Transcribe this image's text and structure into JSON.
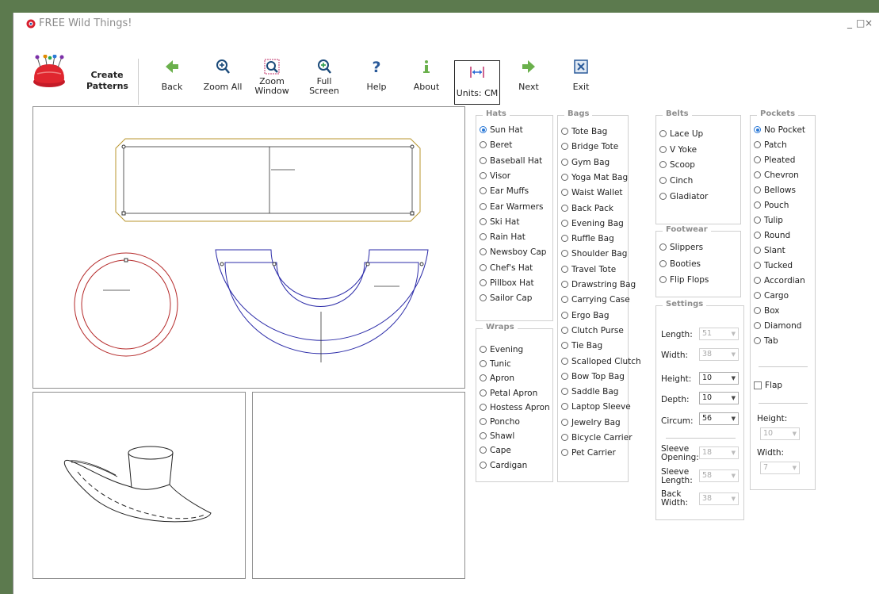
{
  "window": {
    "title": "FREE Wild Things!",
    "minimize": "_",
    "maximize": "□",
    "close": "×"
  },
  "brand": {
    "line1": "Create",
    "line2": "Patterns"
  },
  "toolbar": {
    "back": "Back",
    "zoom_all": "Zoom All",
    "zoom_window": "Zoom\nWindow",
    "full_screen": "Full\nScreen",
    "help": "Help",
    "about": "About",
    "units": "Units: CM",
    "next": "Next",
    "exit": "Exit"
  },
  "hats": {
    "title": "Hats",
    "items": [
      "Sun Hat",
      "Beret",
      "Baseball Hat",
      "Visor",
      "Ear Muffs",
      "Ear Warmers",
      "Ski Hat",
      "Rain Hat",
      "Newsboy Cap",
      "Chef's Hat",
      "Pillbox Hat",
      "Sailor Cap"
    ],
    "selected": "Sun Hat"
  },
  "wraps": {
    "title": "Wraps",
    "items": [
      "Evening",
      "Tunic",
      "Apron",
      "Petal Apron",
      "Hostess Apron",
      "Poncho",
      "Shawl",
      "Cape",
      "Cardigan"
    ]
  },
  "bags": {
    "title": "Bags",
    "items": [
      "Tote Bag",
      "Bridge Tote",
      "Gym Bag",
      "Yoga Mat Bag",
      "Waist Wallet",
      "Back Pack",
      "Evening Bag",
      "Ruffle Bag",
      "Shoulder Bag",
      "Travel Tote",
      "Drawstring Bag",
      "Carrying Case",
      "Ergo Bag",
      "Clutch Purse",
      "Tie Bag",
      "Scalloped Clutch",
      "Bow Top Bag",
      "Saddle Bag",
      "Laptop Sleeve",
      "Jewelry Bag",
      "Bicycle Carrier",
      "Pet Carrier"
    ]
  },
  "belts": {
    "title": "Belts",
    "items": [
      "Lace Up",
      "V Yoke",
      "Scoop",
      "Cinch",
      "Gladiator"
    ]
  },
  "footwear": {
    "title": "Footwear",
    "items": [
      "Slippers",
      "Booties",
      "Flip Flops"
    ]
  },
  "settings": {
    "title": "Settings",
    "length": {
      "label": "Length:",
      "value": "51"
    },
    "width": {
      "label": "Width:",
      "value": "38"
    },
    "height": {
      "label": "Height:",
      "value": "10"
    },
    "depth": {
      "label": "Depth:",
      "value": "10"
    },
    "circum": {
      "label": "Circum:",
      "value": "56"
    },
    "sleeve_opening": {
      "label1": "Sleeve",
      "label2": "Opening:",
      "value": "18"
    },
    "sleeve_length": {
      "label1": "Sleeve",
      "label2": "Length:",
      "value": "58"
    },
    "back_width": {
      "label1": "Back",
      "label2": "Width:",
      "value": "38"
    }
  },
  "pockets": {
    "title": "Pockets",
    "items": [
      "No Pocket",
      "Patch",
      "Pleated",
      "Chevron",
      "Bellows",
      "Pouch",
      "Tulip",
      "Round",
      "Slant",
      "Tucked",
      "Accordian",
      "Cargo",
      "Box",
      "Diamond",
      "Tab"
    ],
    "selected": "No Pocket",
    "flap": "Flap",
    "height": {
      "label": "Height:",
      "value": "10"
    },
    "width": {
      "label": "Width:",
      "value": "7"
    }
  },
  "colors": {
    "band": "#b8962e",
    "crown": "#b52a2a",
    "brim": "#2b2ba8",
    "accent": "#2a78d6",
    "logo": "#d8202f"
  }
}
